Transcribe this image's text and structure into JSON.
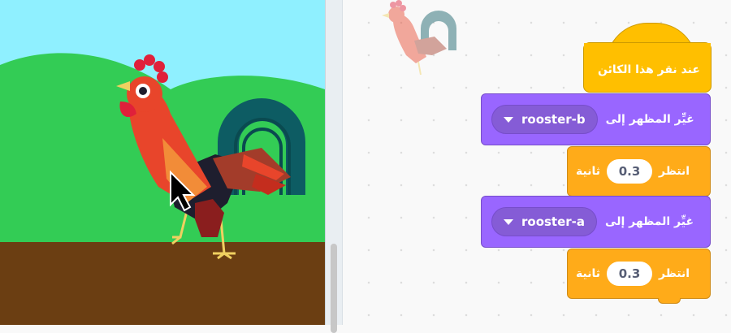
{
  "stage": {
    "sprite": "rooster-icon",
    "cursor": "arrow-cursor-icon",
    "colors": {
      "sky": "#8ff0ff",
      "hills": "#33cc55",
      "ground": "#6b3e12"
    }
  },
  "workspace": {
    "sprite_thumbnail": "rooster-icon",
    "script": {
      "hat_label": "عند نقر هذا الكائن",
      "blocks": [
        {
          "type": "looks",
          "label": "غيِّر المظهر إلى",
          "costume": "rooster-b"
        },
        {
          "type": "control",
          "label_wait": "انتظر",
          "value": "0.3",
          "label_unit": "ثانية"
        },
        {
          "type": "looks",
          "label": "غيِّر المظهر إلى",
          "costume": "rooster-a"
        },
        {
          "type": "control",
          "label_wait": "انتظر",
          "value": "0.3",
          "label_unit": "ثانية"
        }
      ]
    },
    "colors": {
      "event": "#ffbf00",
      "looks": "#9966ff",
      "control": "#ffab19"
    }
  }
}
